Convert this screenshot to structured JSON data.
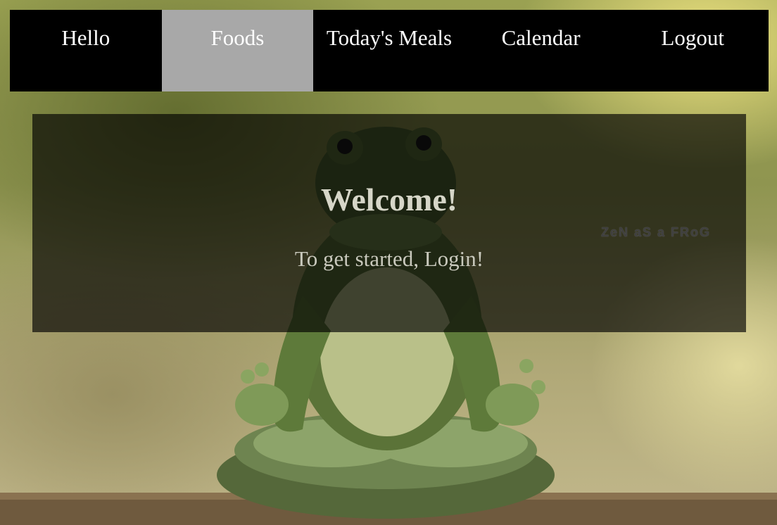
{
  "nav": {
    "items": [
      {
        "label": "Hello"
      },
      {
        "label": "Foods"
      },
      {
        "label": "Today's Meals"
      },
      {
        "label": "Calendar"
      },
      {
        "label": "Logout"
      }
    ],
    "active_index": 1
  },
  "welcome": {
    "title": "Welcome!",
    "subtitle": "To get started, Login!"
  },
  "background": {
    "watermark": "ZeN aS a FRoG"
  },
  "colors": {
    "nav_background": "#000000",
    "nav_active_background": "#a8a8a8",
    "nav_text": "#ffffff",
    "panel_overlay": "rgba(0,0,0,0.66)"
  }
}
